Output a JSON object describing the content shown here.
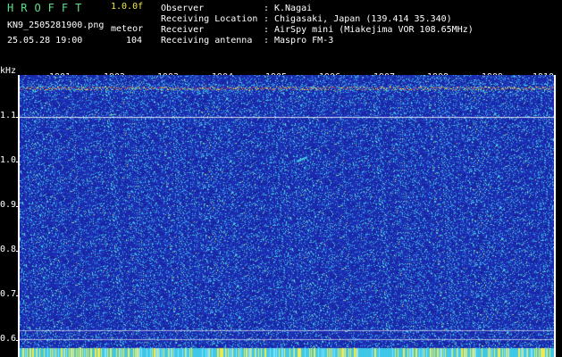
{
  "header": {
    "brand": "HROFFT",
    "version": "1.0.0f",
    "filename": "KN9_2505281900.png",
    "mode": "meteor",
    "datetime": "25.05.28 19:00",
    "count": "104"
  },
  "station": [
    {
      "key": "Observer",
      "value": "K.Nagai"
    },
    {
      "key": "Receiving Location",
      "value": "Chigasaki, Japan (139.414 35.340)"
    },
    {
      "key": "Receiver",
      "value": "AirSpy mini (Miakejima VOR 108.65MHz)"
    },
    {
      "key": "Receiving antenna",
      "value": "Maspro FM-3"
    }
  ],
  "spectrogram": {
    "y_unit": "kHz",
    "y_ticks": [
      "1.1",
      "1.0",
      "0.9",
      "0.8",
      "0.7",
      "0.6"
    ],
    "x_ticks": [
      "1901",
      "1902",
      "1903",
      "1904",
      "1905",
      "1906",
      "1907",
      "1908",
      "1909",
      "1910"
    ],
    "colors": {
      "background": "#1d2fb8",
      "noise": "#3ec7e6",
      "hot": "#f2e94a",
      "carrier": "#e24a4a"
    }
  }
}
